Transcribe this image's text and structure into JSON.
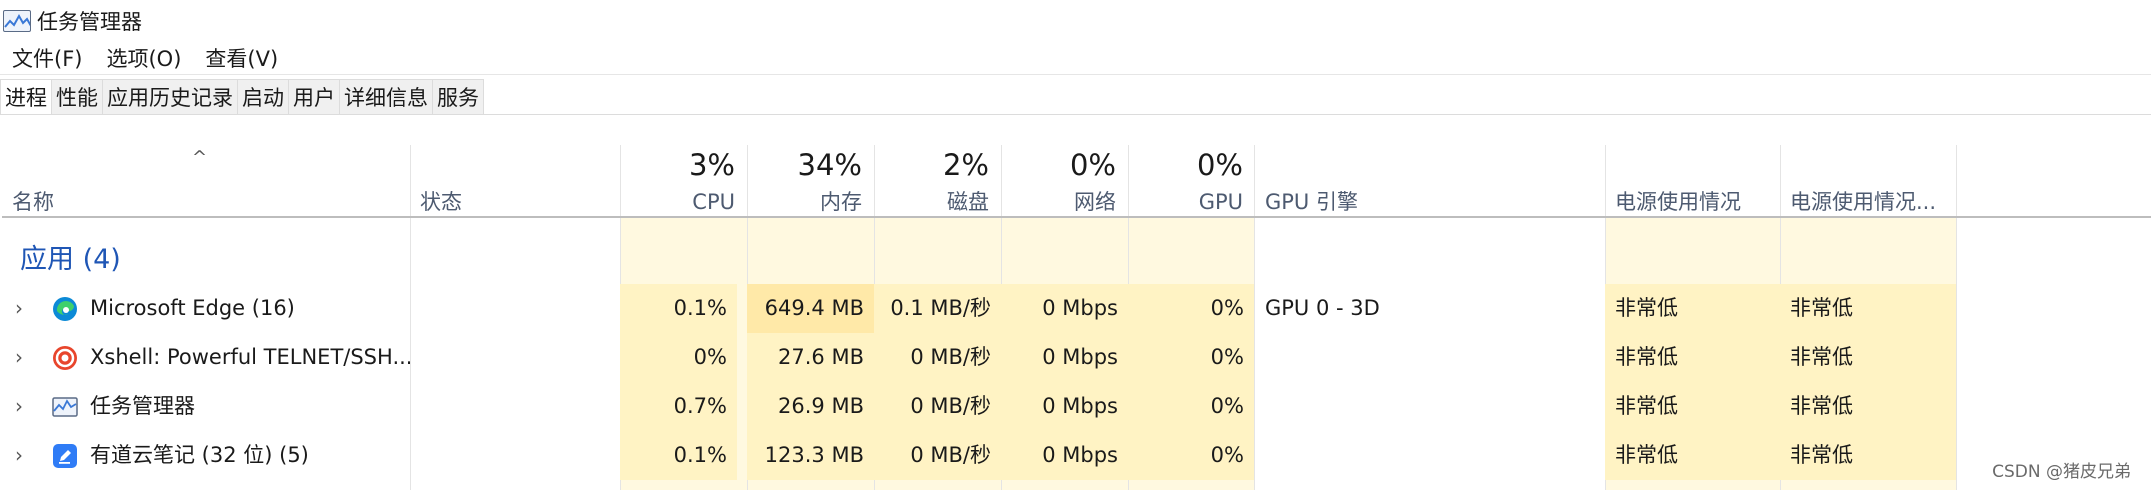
{
  "window": {
    "title": "任务管理器",
    "icon": "task-manager-icon"
  },
  "menu": [
    "文件(F)",
    "选项(O)",
    "查看(V)"
  ],
  "tabs": [
    "进程",
    "性能",
    "应用历史记录",
    "启动",
    "用户",
    "详细信息",
    "服务"
  ],
  "active_tab": "进程",
  "columns": {
    "name": "名称",
    "status": "状态",
    "cpu": {
      "pct": "3%",
      "label": "CPU"
    },
    "memory": {
      "pct": "34%",
      "label": "内存"
    },
    "disk": {
      "pct": "2%",
      "label": "磁盘"
    },
    "network": {
      "pct": "0%",
      "label": "网络"
    },
    "gpu": {
      "pct": "0%",
      "label": "GPU"
    },
    "gpu_engine": "GPU 引擎",
    "power": "电源使用情况",
    "power_trend": "电源使用情况..."
  },
  "group": {
    "title": "应用 (4)"
  },
  "rows": [
    {
      "name": "Microsoft Edge (16)",
      "icon": "edge-icon",
      "cpu": "0.1%",
      "memory": "649.4 MB",
      "disk": "0.1 MB/秒",
      "network": "0 Mbps",
      "gpu": "0%",
      "gpu_engine": "GPU 0 - 3D",
      "power": "非常低",
      "power_trend": "非常低"
    },
    {
      "name": "Xshell: Powerful TELNET/SSH...",
      "icon": "xshell-icon",
      "cpu": "0%",
      "memory": "27.6 MB",
      "disk": "0 MB/秒",
      "network": "0 Mbps",
      "gpu": "0%",
      "gpu_engine": "",
      "power": "非常低",
      "power_trend": "非常低"
    },
    {
      "name": "任务管理器",
      "icon": "task-manager-icon",
      "cpu": "0.7%",
      "memory": "26.9 MB",
      "disk": "0 MB/秒",
      "network": "0 Mbps",
      "gpu": "0%",
      "gpu_engine": "",
      "power": "非常低",
      "power_trend": "非常低"
    },
    {
      "name": "有道云笔记 (32 位) (5)",
      "icon": "youdao-note-icon",
      "cpu": "0.1%",
      "memory": "123.3 MB",
      "disk": "0 MB/秒",
      "network": "0 Mbps",
      "gpu": "0%",
      "gpu_engine": "",
      "power": "非常低",
      "power_trend": "非常低"
    }
  ],
  "watermark": "CSDN @猪皮兄弟",
  "colors": {
    "heat_light": "#fff9e0",
    "heat_mid": "#fff3c4",
    "heat_strong": "#ffe9a8",
    "group_title": "#1f56b5"
  }
}
